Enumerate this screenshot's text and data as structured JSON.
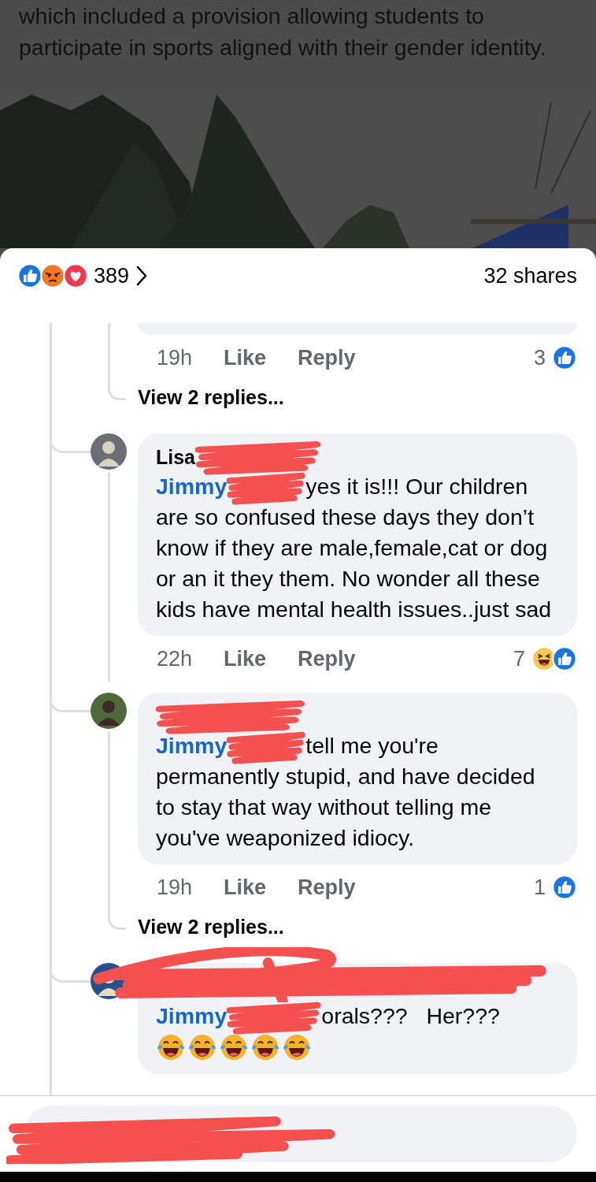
{
  "post": {
    "caption": "which included a provision allowing students to participate in sports aligned with their gender identity."
  },
  "summary": {
    "reactions": [
      {
        "kind": "like"
      },
      {
        "kind": "angry"
      },
      {
        "kind": "love"
      }
    ],
    "count": "389",
    "shares": "32 shares"
  },
  "comments": [
    {
      "kind": "partial",
      "time": "19h",
      "like": "Like",
      "reply": "Reply",
      "reaction_count": "3",
      "reactions": [
        {
          "kind": "like"
        }
      ],
      "view_replies": "View 2 replies..."
    },
    {
      "kind": "full",
      "scribbled": false,
      "author": [
        {
          "kind": "text",
          "text": "Lisa"
        },
        {
          "kind": "redaction"
        }
      ],
      "body": [
        {
          "kind": "mention",
          "text": "Jimmy"
        },
        {
          "kind": "redaction"
        },
        {
          "kind": "text",
          "text": "yes it is!!! Our children are so confused these days they don’t know if they are male,female,cat or dog or an it they them. No wonder all these kids have mental health issues..just sad"
        }
      ],
      "time": "22h",
      "like": "Like",
      "reply": "Reply",
      "reaction_count": "7",
      "reactions": [
        {
          "kind": "haha"
        },
        {
          "kind": "like"
        }
      ]
    },
    {
      "kind": "full",
      "scribbled": false,
      "author": [
        {
          "kind": "redaction"
        }
      ],
      "body": [
        {
          "kind": "mention",
          "text": "Jimmy"
        },
        {
          "kind": "redaction"
        },
        {
          "kind": "text",
          "text": "tell me you're permanently stupid, and have decided to stay that way without telling me you've weaponized idiocy."
        }
      ],
      "time": "19h",
      "like": "Like",
      "reply": "Reply",
      "reaction_count": "1",
      "reactions": [
        {
          "kind": "like"
        }
      ],
      "view_replies": "View 2 replies..."
    },
    {
      "kind": "full",
      "scribbled": true,
      "body": [
        {
          "kind": "mention",
          "text": "Jimmy"
        },
        {
          "kind": "redaction"
        },
        {
          "kind": "text",
          "text": "orals???   Her???"
        }
      ],
      "emojis": [
        {
          "kind": "laughing"
        },
        {
          "kind": "laughing"
        },
        {
          "kind": "laughing"
        },
        {
          "kind": "laughing"
        },
        {
          "kind": "laughing"
        }
      ]
    }
  ],
  "composer": {
    "content": [
      {
        "kind": "redaction"
      }
    ]
  }
}
